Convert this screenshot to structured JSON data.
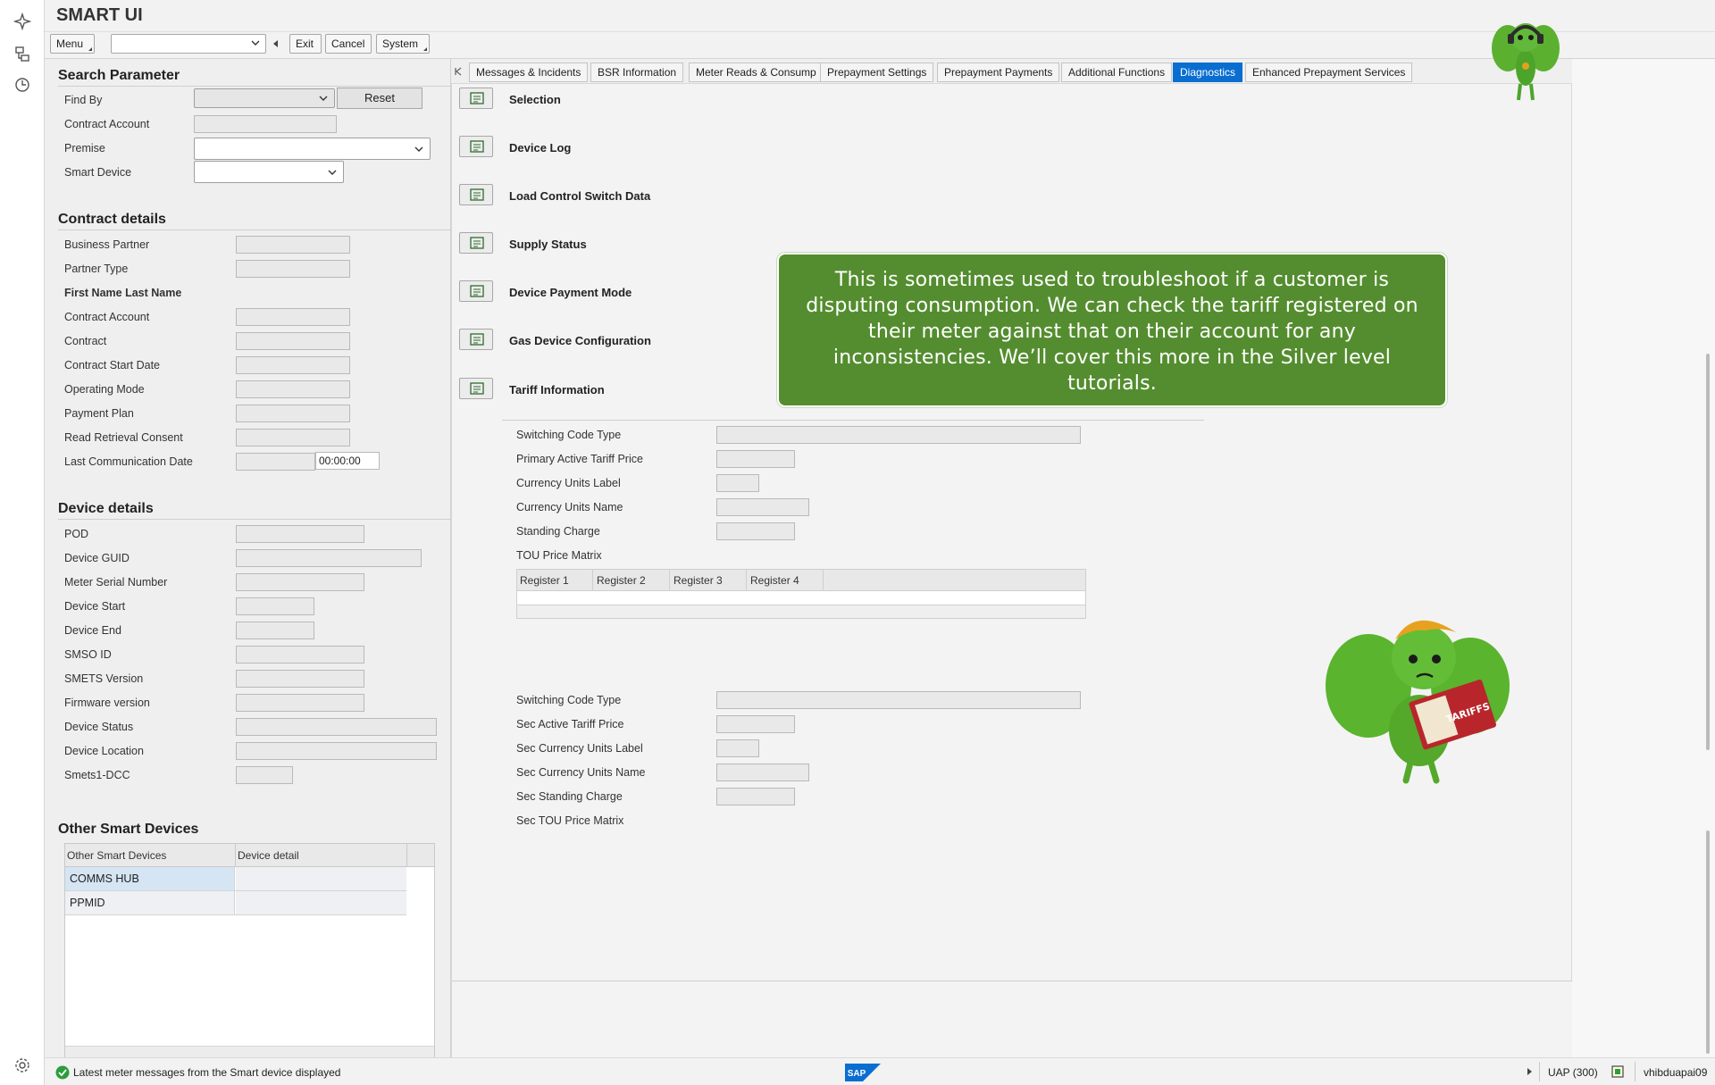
{
  "app": {
    "title": "SMART UI"
  },
  "toolbar": {
    "menu": "Menu",
    "exit": "Exit",
    "cancel": "Cancel",
    "system": "System"
  },
  "search": {
    "title": "Search Parameter",
    "find_by": "Find By",
    "reset": "Reset",
    "contract_account": "Contract Account",
    "premise": "Premise",
    "smart_device": "Smart Device"
  },
  "contract": {
    "title": "Contract details",
    "business_partner": "Business Partner",
    "partner_type": "Partner Type",
    "name": "First Name Last Name",
    "contract_account": "Contract Account",
    "contract": "Contract",
    "start_date": "Contract Start Date",
    "operating_mode": "Operating Mode",
    "payment_plan": "Payment Plan",
    "read_retrieval": "Read Retrieval Consent",
    "last_comm": "Last Communication Date",
    "last_comm_time": "00:00:00"
  },
  "device": {
    "title": "Device details",
    "pod": "POD",
    "guid": "Device GUID",
    "meter_serial": "Meter Serial Number",
    "start": "Device Start",
    "end": "Device End",
    "smso": "SMSO ID",
    "smets": "SMETS Version",
    "firmware": "Firmware version",
    "status": "Device Status",
    "location": "Device Location",
    "dcc": "Smets1-DCC"
  },
  "other_devices": {
    "title": "Other Smart Devices",
    "col1": "Other Smart Devices",
    "col2": "Device detail",
    "rows": [
      "COMMS HUB",
      "PPMID"
    ]
  },
  "tabs": [
    "Messages & Incidents",
    "BSR Information",
    "Meter Reads & Consump",
    "Prepayment Settings",
    "Prepayment Payments",
    "Additional Functions",
    "Diagnostics",
    "Enhanced Prepayment Services"
  ],
  "diagnostics": {
    "items": [
      "Selection",
      "Device Log",
      "Load Control Switch Data",
      "Supply Status",
      "Device Payment Mode",
      "Gas Device Configuration",
      "Tariff Information"
    ],
    "tariff": {
      "switching_code": "Switching Code Type",
      "primary_price": "Primary Active Tariff Price",
      "currency_label": "Currency Units Label",
      "currency_name": "Currency Units Name",
      "standing_charge": "Standing Charge",
      "tou_matrix": "TOU Price Matrix",
      "registers": [
        "Register 1",
        "Register 2",
        "Register 3",
        "Register 4"
      ]
    },
    "sec": {
      "switching_code": "Switching Code Type",
      "active_price": "Sec Active Tariff Price",
      "currency_label": "Sec Currency Units Label",
      "currency_name": "Sec Currency Units Name",
      "standing_charge": "Sec Standing Charge",
      "tou_matrix": "Sec TOU Price Matrix"
    }
  },
  "callout": {
    "text": "This is sometimes used to troubleshoot if a customer is disputing consumption. We can check the tariff registered on their meter against that on their account for any inconsistencies. We’ll cover this more in the Silver level tutorials."
  },
  "mascot": {
    "book_label": "TARIFFS"
  },
  "status": {
    "message": "Latest meter messages from the Smart device displayed",
    "system": "UAP (300)",
    "user": "vhibduapai09"
  },
  "colors": {
    "accent": "#0a6ed1",
    "callout": "#548d2f",
    "ok": "#2b9d3a"
  },
  "icons": [
    "sparkle-icon",
    "tree-icon",
    "history-icon",
    "settings-icon",
    "chevron-down-icon",
    "details-icon",
    "check-circle-icon",
    "sap-logo",
    "lock-icon"
  ]
}
